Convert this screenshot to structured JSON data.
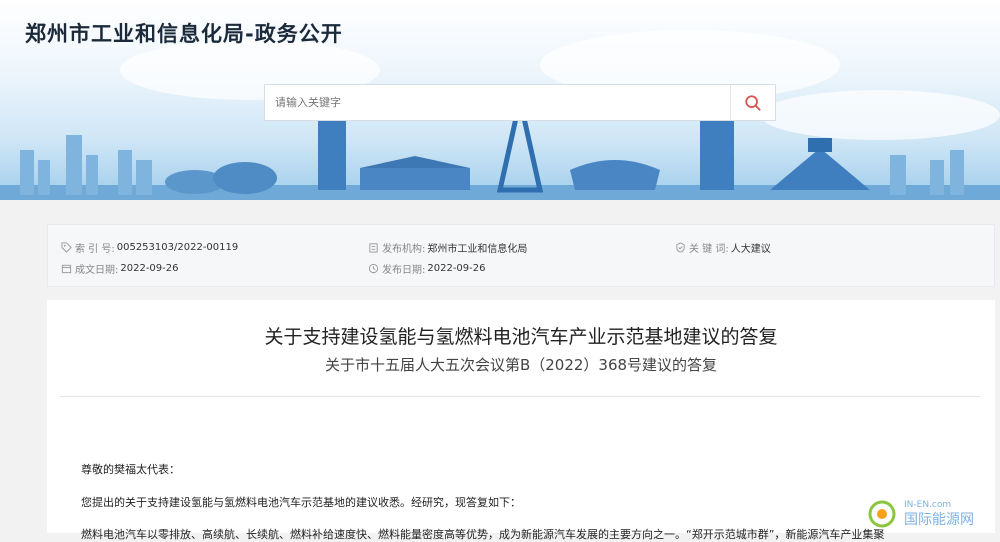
{
  "header": {
    "site_title": "郑州市工业和信息化局-政务公开"
  },
  "search": {
    "placeholder": "请输入关键字",
    "icon": "search-icon"
  },
  "info": {
    "index_label": "索 引 号:",
    "index_value": "005253103/2022-00119",
    "publisher_label": "发布机构:",
    "publisher_value": "郑州市工业和信息化局",
    "keyword_label": "关 键 词:",
    "keyword_value": "人大建议",
    "created_label": "成文日期:",
    "created_value": "2022-09-26",
    "published_label": "发布日期:",
    "published_value": "2022-09-26"
  },
  "article": {
    "title": "关于支持建设氢能与氢燃料电池汽车产业示范基地建议的答复",
    "subtitle": "关于市十五届人大五次会议第B（2022）368号建议的答复",
    "salutation": "尊敬的樊福太代表：",
    "para1": "您提出的关于支持建设氢能与氢燃料电池汽车示范基地的建议收悉。经研究，现答复如下：",
    "para2_partial": "燃料电池汽车以零排放、高续航、长续航、燃料补给速度快、燃料能量密度高等优势，成为新能源汽车发展的主要方向之一。“郑开示范城市群”，新能源汽车产业集聚"
  },
  "watermark": {
    "domain": "IN-EN.com",
    "name": "国际能源网"
  },
  "colors": {
    "accent": "#2f7ad0",
    "search_icon": "#d9534f",
    "banner_bottom": "#9fcdeb"
  }
}
